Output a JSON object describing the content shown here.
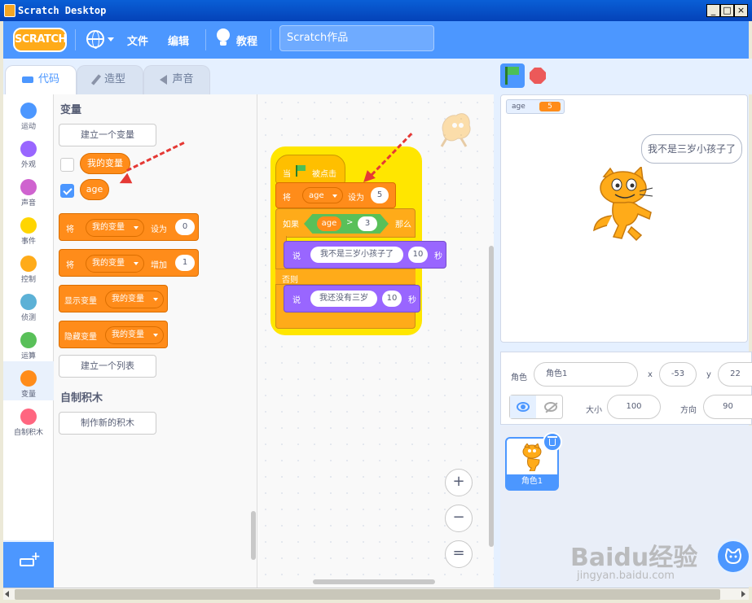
{
  "window": {
    "title": "Scratch Desktop",
    "min": "_",
    "max": "□",
    "close": "×"
  },
  "menubar": {
    "logo": "SCRATCH",
    "file": "文件",
    "edit": "编辑",
    "tutorials": "教程",
    "project_title": "Scratch作品"
  },
  "tabs": [
    {
      "label": "代码"
    },
    {
      "label": "造型"
    },
    {
      "label": "声音"
    }
  ],
  "categories": [
    {
      "label": "运动",
      "color": "#4c97ff"
    },
    {
      "label": "外观",
      "color": "#9966ff"
    },
    {
      "label": "声音",
      "color": "#cf63cf"
    },
    {
      "label": "事件",
      "color": "#ffd500"
    },
    {
      "label": "控制",
      "color": "#ffab19"
    },
    {
      "label": "侦测",
      "color": "#5cb1d6"
    },
    {
      "label": "运算",
      "color": "#59c059"
    },
    {
      "label": "变量",
      "color": "#ff8c1a"
    },
    {
      "label": "自制积木",
      "color": "#ff6680"
    }
  ],
  "palette": {
    "heading": "变量",
    "make_var": "建立一个变量",
    "vars": [
      {
        "name": "我的变量",
        "checked": false
      },
      {
        "name": "age",
        "checked": true
      }
    ],
    "set_block": {
      "verb": "将",
      "var": "我的变量",
      "op": "设为",
      "value": "0"
    },
    "change_block": {
      "verb": "将",
      "var": "我的变量",
      "op": "增加",
      "value": "1"
    },
    "show_block": {
      "op": "显示变量",
      "var": "我的变量"
    },
    "hide_block": {
      "op": "隐藏变量",
      "var": "我的变量"
    },
    "make_list": "建立一个列表",
    "custom_heading": "自制积木",
    "make_block": "制作新的积木"
  },
  "script": {
    "hat_when": "当",
    "hat_clicked": "被点击",
    "set_verb": "将",
    "set_var": "age",
    "set_op": "设为",
    "set_value": "5",
    "if_label": "如果",
    "cond_var": "age",
    "cond_op": ">",
    "cond_value": "3",
    "then_label": "那么",
    "say1_verb": "说",
    "say1_text": "我不是三岁小孩子了",
    "say1_secs": "10",
    "say1_unit": "秒",
    "else_label": "否则",
    "say2_verb": "说",
    "say2_text": "我还没有三岁",
    "say2_secs": "10",
    "say2_unit": "秒"
  },
  "zoom": {
    "in": "+",
    "out": "−",
    "reset": "="
  },
  "stage": {
    "monitor_name": "age",
    "monitor_value": "5",
    "speech": "我不是三岁小孩子了"
  },
  "sprite_info": {
    "sprite_label": "角色",
    "sprite_name": "角色1",
    "x_label": "x",
    "x_value": "-53",
    "y_label": "y",
    "y_value": "22",
    "size_label": "大小",
    "size_value": "100",
    "dir_label": "方向",
    "dir_value": "90"
  },
  "sprite_list": [
    {
      "name": "角色1"
    }
  ],
  "watermark": {
    "brand": "Baidu经验",
    "url": "jingyan.baidu.com"
  }
}
